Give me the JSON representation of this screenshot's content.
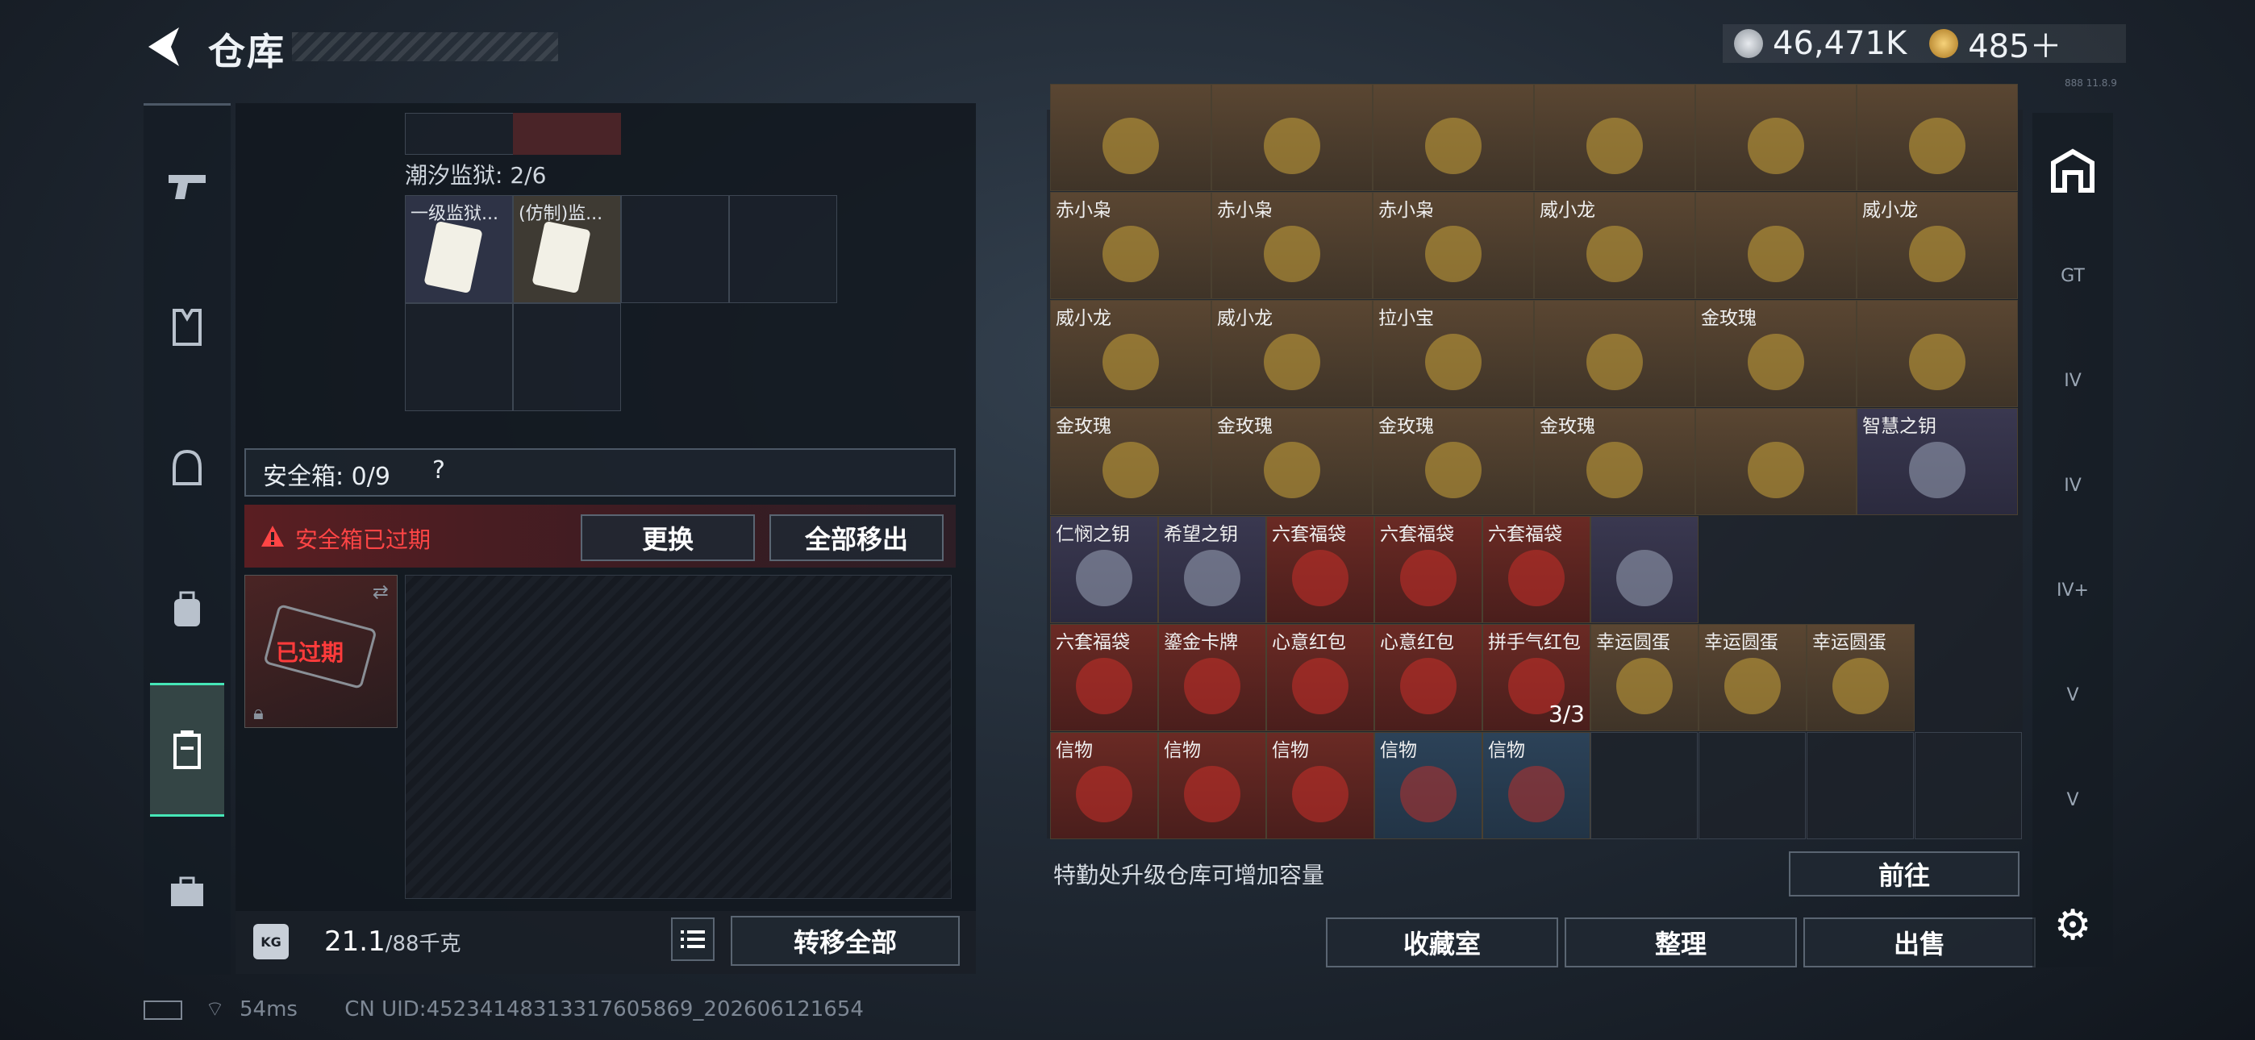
{
  "header": {
    "title": "仓库",
    "currency": [
      {
        "icon": "silver-coin-icon",
        "value": "46,471K"
      },
      {
        "icon": "gold-coin-icon",
        "value": "485＋"
      }
    ],
    "version": "888 11.8.9"
  },
  "left_nav": {
    "items": [
      "pistol-icon",
      "armor-icon",
      "helmet-icon",
      "backpack-icon",
      "safebox-icon",
      "toolbox-icon"
    ],
    "active_index": 4
  },
  "prison": {
    "label": "潮汐监狱: 2/6",
    "items": [
      "一级监狱...",
      "(仿制)监..."
    ]
  },
  "safebox": {
    "label": "安全箱: 0/9",
    "help": "?",
    "expired_notice": "安全箱已过期",
    "replace_btn": "更换",
    "move_all_btn": "全部移出",
    "item_status": "已过期"
  },
  "weight": {
    "current": "21.1",
    "max": "/88千克",
    "transfer_btn": "转移全部"
  },
  "storage": {
    "items": [
      {
        "label": "",
        "color": "gold"
      },
      {
        "label": "",
        "color": "gold"
      },
      {
        "label": "",
        "color": "gold"
      },
      {
        "label": "",
        "color": "gold"
      },
      {
        "label": "",
        "color": "gold"
      },
      {
        "label": "",
        "color": "gold"
      },
      {
        "label": "赤小枭",
        "color": "gold"
      },
      {
        "label": "赤小枭",
        "color": "gold"
      },
      {
        "label": "赤小枭",
        "color": "gold"
      },
      {
        "label": "威小龙",
        "color": "gold"
      },
      {
        "label": "",
        "color": "gold"
      },
      {
        "label": "威小龙",
        "color": "gold"
      },
      {
        "label": "威小龙",
        "color": "gold"
      },
      {
        "label": "威小龙",
        "color": "gold"
      },
      {
        "label": "拉小宝",
        "color": "gold"
      },
      {
        "label": "",
        "color": "gold"
      },
      {
        "label": "金玫瑰",
        "color": "gold"
      },
      {
        "label": "",
        "color": "gold"
      },
      {
        "label": "金玫瑰",
        "color": "gold"
      },
      {
        "label": "金玫瑰",
        "color": "gold"
      },
      {
        "label": "金玫瑰",
        "color": "gold"
      },
      {
        "label": "金玫瑰",
        "color": "gold"
      },
      {
        "label": "",
        "color": "gold"
      },
      {
        "label": "智慧之钥",
        "color": "purple"
      },
      {
        "label": "仁悯之钥",
        "color": "purple"
      },
      {
        "label": "希望之钥",
        "color": "purple"
      },
      {
        "label": "六套福袋",
        "color": "red"
      },
      {
        "label": "六套福袋",
        "color": "red"
      },
      {
        "label": "六套福袋",
        "color": "red"
      },
      {
        "label": "",
        "color": "purple"
      },
      {
        "label": "六套福袋",
        "color": "red"
      },
      {
        "label": "鎏金卡牌",
        "color": "red"
      },
      {
        "label": "心意红包",
        "color": "red"
      },
      {
        "label": "心意红包",
        "color": "red"
      },
      {
        "label": "拼手气红包",
        "color": "red",
        "count": "3/3"
      },
      {
        "label": "幸运圆蛋",
        "color": "gold"
      },
      {
        "label": "幸运圆蛋",
        "color": "gold"
      },
      {
        "label": "幸运圆蛋",
        "color": "gold"
      },
      {
        "label": "幸运圆蛋",
        "color": "gold"
      },
      {
        "label": "信物",
        "color": "red"
      },
      {
        "label": "信物",
        "color": "red"
      },
      {
        "label": "信物",
        "color": "red"
      },
      {
        "label": "信物",
        "color": "blue"
      },
      {
        "label": "信物",
        "color": "blue"
      }
    ],
    "upgrade_text": "特勤处升级仓库可增加容量",
    "goto_btn": "前往",
    "buttons": [
      "收藏室",
      "整理",
      "出售"
    ]
  },
  "right_nav": {
    "items": [
      "storage-home-icon",
      "GT",
      "IV",
      "IV",
      "IV+",
      "V",
      "V"
    ]
  },
  "footer": {
    "ping": "54ms",
    "uid": "CN UID:4523414831331760586​9_202606121654"
  }
}
